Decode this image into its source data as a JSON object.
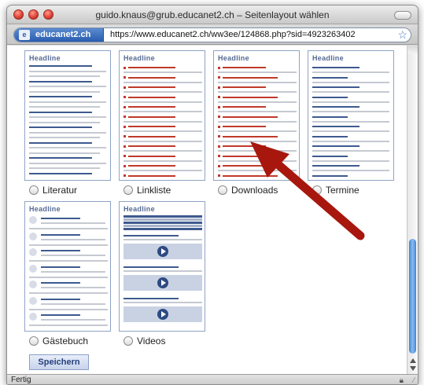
{
  "window": {
    "title": "guido.knaus@grub.educanet2.ch – Seitenlayout wählen"
  },
  "urlbar": {
    "site_name": "educanet2.ch",
    "site_icon": "educanet-icon",
    "url": "https://www.educanet2.ch/ww3ee/124868.php?sid=4923263402",
    "bookmark_icon": "star-icon"
  },
  "layouts": [
    {
      "label": "Literatur",
      "headline": "Headline"
    },
    {
      "label": "Linkliste",
      "headline": "Headline"
    },
    {
      "label": "Downloads",
      "headline": "Headline"
    },
    {
      "label": "Termine",
      "headline": "Headline"
    },
    {
      "label": "Gästebuch",
      "headline": "Headline"
    },
    {
      "label": "Videos",
      "headline": "Headline"
    }
  ],
  "save_button": {
    "label": "Speichern"
  },
  "status": {
    "text": "Fertig"
  },
  "colors": {
    "accent": "#2d4a83",
    "link_red": "#c0392b",
    "arrow": "#a8170e",
    "thumb_border": "#8fa3c6"
  }
}
